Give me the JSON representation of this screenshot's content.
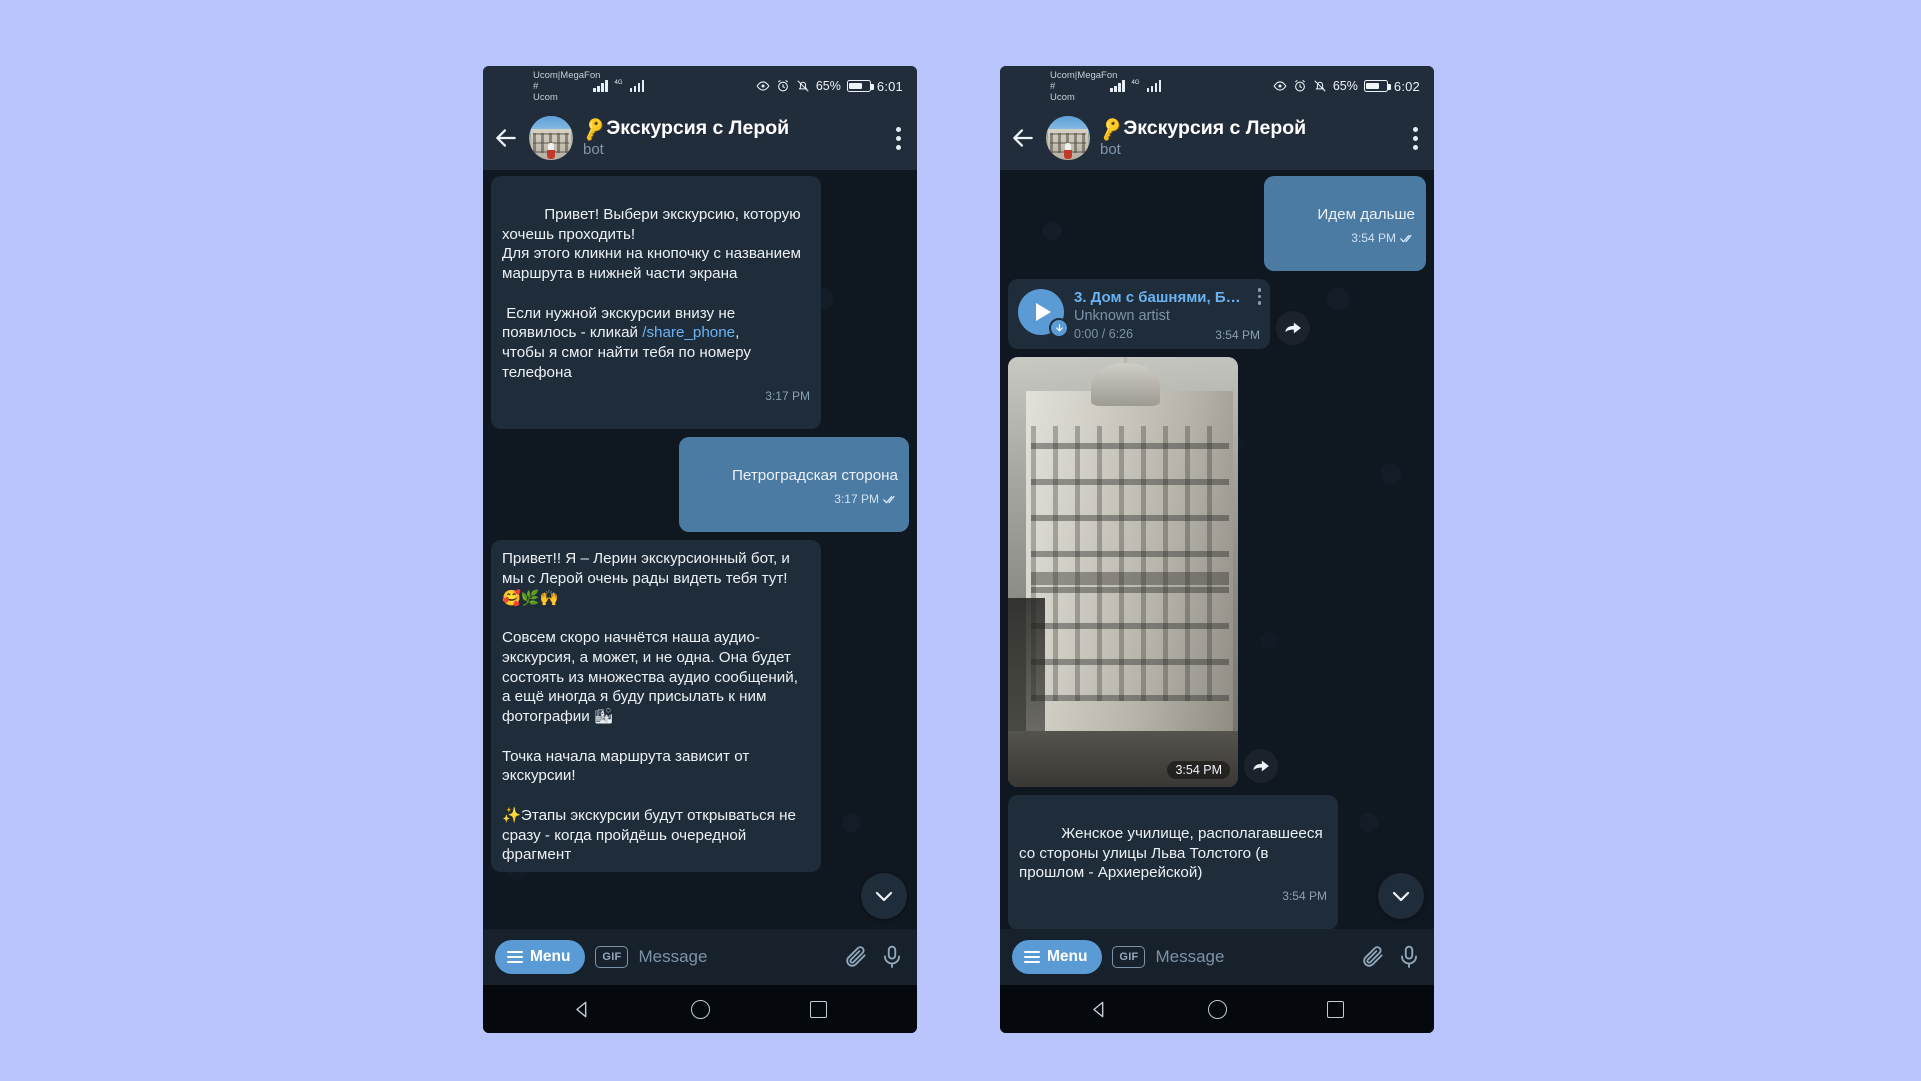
{
  "status_bar": {
    "carrier_line1": "Ucom|MegaFon #",
    "carrier_line2": "Ucom",
    "network_label": "4G",
    "battery_percent": "65%",
    "time_left": "6:01",
    "time_right": "6:02"
  },
  "header": {
    "title": "Экскурсия с Лерой",
    "key_icon": "🔑",
    "subtitle": "bot",
    "back_icon": "back-arrow-icon",
    "menu_icon": "kebab-menu-icon"
  },
  "left_phone": {
    "messages": [
      {
        "id": "bot-intro",
        "direction": "in",
        "text": "Привет! Выбери экскурсию, которую хочешь проходить!\nДля этого кликни на кнопочку с названием маршрута в нижней части экрана\n\n Если нужной экскурсии внизу не появилось - кликай ",
        "link": "/share_phone",
        "text_after": ",\nчтобы я смог найти тебя по номеру телефона",
        "time": "3:17 PM"
      },
      {
        "id": "user-choice",
        "direction": "out",
        "text": "Петроградская сторона",
        "time": "3:17 PM",
        "read": true
      },
      {
        "id": "bot-welcome",
        "direction": "in",
        "text": "Привет!! Я – Лерин экскурсионный бот, и мы с Лерой очень рады видеть тебя тут! 🥰🌿🙌\n\nСовсем скоро начнётся наша аудио-экскурсия, а может, и не одна. Она будет состоять из множества аудио сообщений, а ещё иногда я буду присылать к ним фотографии 🏙\n\nТочка начала маршрута зависит от экскурсии!\n\n✨Этапы экскурсии будут открываться не сразу - когда пройдёшь очередной фрагмент",
        "time": ""
      }
    ]
  },
  "right_phone": {
    "messages": [
      {
        "id": "user-next",
        "direction": "out",
        "text": "Идем дальше",
        "time": "3:54 PM",
        "read": true
      },
      {
        "id": "audio-track",
        "direction": "in",
        "type": "audio",
        "title": "3. Дом с башнями, Б…",
        "artist": "Unknown artist",
        "duration": "0:00 / 6:26",
        "time": "3:54 PM"
      },
      {
        "id": "photo-message",
        "direction": "in",
        "type": "photo",
        "time": "3:54 PM"
      },
      {
        "id": "photo-caption",
        "direction": "in",
        "text": "Женское училище, располагавшееся со стороны улицы Льва Толстого (в прошлом - Архиерейской)",
        "time": "3:54 PM"
      }
    ]
  },
  "input_bar": {
    "menu_label": "Menu",
    "gif_label": "GIF",
    "message_placeholder": "Message",
    "attach_icon": "paperclip-icon",
    "voice_icon": "microphone-icon"
  },
  "nav_bar": {
    "back": "nav-back-triangle",
    "home": "nav-home-circle",
    "recents": "nav-recents-square"
  },
  "colors": {
    "page_background": "#b8c4fb",
    "chat_background": "#0f1720",
    "header_background": "#212d3b",
    "bubble_in": "#1f2c39",
    "bubble_out": "#4b7aa3",
    "accent": "#5b9bd5",
    "link": "#6ab3f3"
  }
}
